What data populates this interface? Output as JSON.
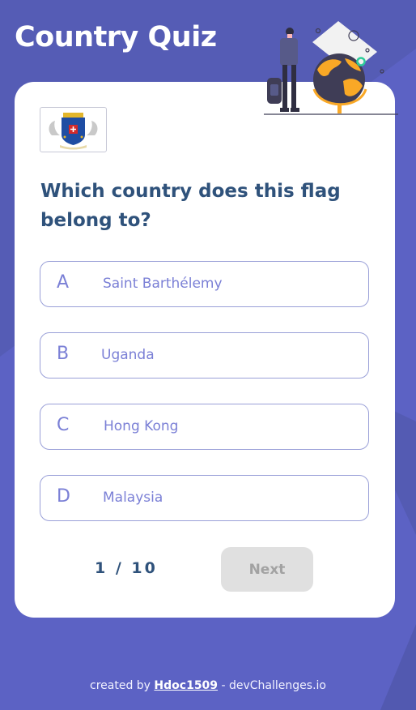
{
  "header": {
    "title": "Country Quiz"
  },
  "quiz": {
    "question": "Which country does this flag belong to?",
    "options": [
      {
        "letter": "A",
        "text": "Saint Barthélemy"
      },
      {
        "letter": "B",
        "text": "Uganda"
      },
      {
        "letter": "C",
        "text": "Hong Kong"
      },
      {
        "letter": "D",
        "text": "Malaysia"
      }
    ],
    "progress": "1 / 10",
    "next_label": "Next"
  },
  "footer": {
    "prefix": "created by ",
    "author": "Hdoc1509",
    "suffix": " - devChallenges.io"
  },
  "colors": {
    "background": "#5c62c4",
    "heading": "#2f527b",
    "option_text": "#7b80d6",
    "option_border": "#9aa0d8",
    "next_disabled": "#e0e0e0"
  }
}
